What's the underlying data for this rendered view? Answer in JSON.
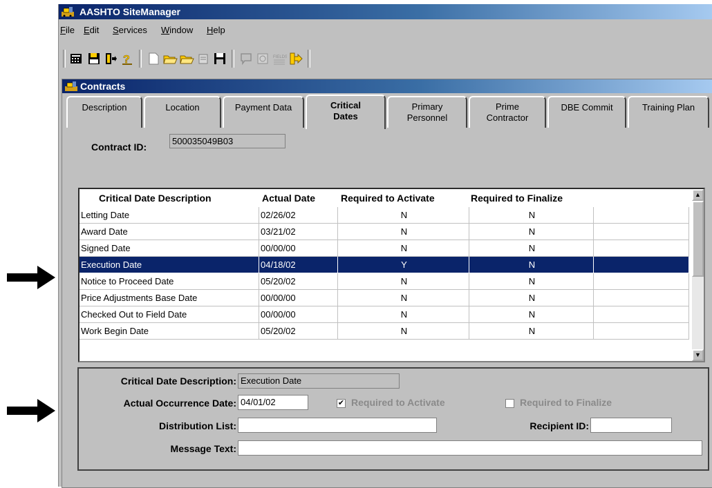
{
  "app": {
    "title": "AASHTO SiteManager"
  },
  "menu": [
    {
      "label": "File",
      "u": "F",
      "rest": "ile"
    },
    {
      "label": "Edit",
      "u": "E",
      "rest": "dit"
    },
    {
      "label": "Services",
      "u": "S",
      "rest": "ervices"
    },
    {
      "label": "Window",
      "u": "W",
      "rest": "indow"
    },
    {
      "label": "Help",
      "u": "H",
      "rest": "elp"
    }
  ],
  "toolbar_icons": [
    "calculator-icon",
    "save-disk-icon",
    "exit-door-icon",
    "help-icon",
    "new-document-icon",
    "open-folder-icon",
    "open-folder-2-icon",
    "edit-icon",
    "save-icon",
    "comment-icon",
    "refresh-icon",
    "fields-icon",
    "arrow-icon"
  ],
  "child": {
    "title": "Contracts"
  },
  "tabs": [
    {
      "line1": "Description",
      "line2": ""
    },
    {
      "line1": "Location",
      "line2": ""
    },
    {
      "line1": "Payment Data",
      "line2": ""
    },
    {
      "line1": "Critical",
      "line2": "Dates"
    },
    {
      "line1": "Primary",
      "line2": "Personnel"
    },
    {
      "line1": "Prime",
      "line2": "Contractor"
    },
    {
      "line1": "DBE Commit",
      "line2": ""
    },
    {
      "line1": "Training Plan",
      "line2": ""
    }
  ],
  "contract": {
    "label": "Contract ID:",
    "value": "500035049B03"
  },
  "grid": {
    "columns": [
      "Critical Date Description",
      "Actual Date",
      "Required to Activate",
      "Required to Finalize"
    ],
    "rows": [
      {
        "desc": "Letting Date",
        "date": "02/26/02",
        "act": "N",
        "fin": "N"
      },
      {
        "desc": "Award Date",
        "date": "03/21/02",
        "act": "N",
        "fin": "N"
      },
      {
        "desc": "Signed Date",
        "date": "00/00/00",
        "act": "N",
        "fin": "N"
      },
      {
        "desc": "Execution Date",
        "date": "04/18/02",
        "act": "Y",
        "fin": "N"
      },
      {
        "desc": "Notice to Proceed Date",
        "date": "05/20/02",
        "act": "N",
        "fin": "N"
      },
      {
        "desc": "Price Adjustments Base Date",
        "date": "00/00/00",
        "act": "N",
        "fin": "N"
      },
      {
        "desc": "Checked Out to Field Date",
        "date": "00/00/00",
        "act": "N",
        "fin": "N"
      },
      {
        "desc": "Work Begin Date",
        "date": "05/20/02",
        "act": "N",
        "fin": "N"
      }
    ],
    "selected_row": 3
  },
  "detail": {
    "desc_label": "Critical Date Description:",
    "desc_value": "Execution Date",
    "date_label": "Actual Occurrence Date:",
    "date_value": "04/01/02",
    "activate_label": "Required to Activate",
    "activate_checked": true,
    "finalize_label": "Required to Finalize",
    "finalize_checked": false,
    "dist_label": "Distribution List:",
    "dist_value": "",
    "recipient_label": "Recipient ID:",
    "recipient_value": "",
    "msg_label": "Message Text:",
    "msg_value": ""
  },
  "colors": {
    "titlebar": "#0a246a",
    "selection": "#0a246a",
    "face": "#c0c0c0"
  }
}
